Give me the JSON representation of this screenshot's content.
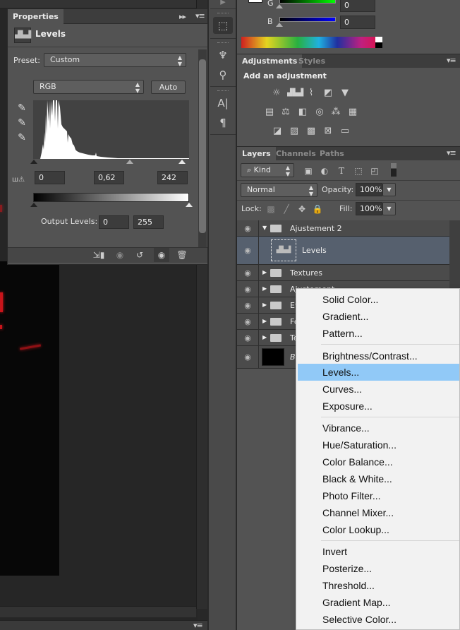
{
  "properties_panel": {
    "tab_label": "Properties",
    "collapse_icon": "double-chevron-right-icon",
    "menu_icon": "panel-menu-icon",
    "title": "Levels",
    "title_icon": "levels-histogram-icon",
    "preset_label": "Preset:",
    "preset_value": "Custom",
    "channel_value": "RGB",
    "auto_button": "Auto",
    "eyedroppers": [
      "black-point-eyedropper-icon",
      "gray-point-eyedropper-icon",
      "white-point-eyedropper-icon"
    ],
    "input_black": "0",
    "input_gamma": "0,62",
    "input_white": "242",
    "output_label": "Output Levels:",
    "output_black": "0",
    "output_white": "255",
    "footer_icons": [
      "clip-to-layer-icon",
      "view-previous-state-icon",
      "reset-icon",
      "visibility-eye-icon",
      "delete-icon"
    ]
  },
  "histogram": {
    "input_black_level": 0,
    "input_gamma": 0.62,
    "input_white_level": 242,
    "range": [
      0,
      255
    ]
  },
  "dock": {
    "icons": [
      "3d-icon",
      "brush-presets-icon",
      "brushes-icon",
      "character-icon",
      "paragraph-icon"
    ]
  },
  "color_panel": {
    "channels": [
      {
        "label": "G",
        "value": "0"
      },
      {
        "label": "B",
        "value": "0"
      }
    ]
  },
  "adjustments_panel": {
    "tabs": [
      "Adjustments",
      "Styles"
    ],
    "subtitle": "Add an adjustment",
    "icons_row1": [
      "brightness-contrast-icon",
      "levels-icon",
      "curves-icon",
      "exposure-icon",
      "gradient-triangle-icon"
    ],
    "icons_row2": [
      "vibrance-icon",
      "color-balance-icon",
      "black-white-icon",
      "photo-filter-icon",
      "channel-mixer-icon",
      "color-lookup-icon"
    ],
    "icons_row3": [
      "invert-icon",
      "posterize-icon",
      "threshold-icon",
      "selective-color-icon",
      "gradient-map-icon"
    ]
  },
  "layers_panel": {
    "tabs": [
      "Layers",
      "Channels",
      "Paths"
    ],
    "filter_value": "Kind",
    "blend_mode": "Normal",
    "opacity_label": "Opacity:",
    "opacity_value": "100%",
    "lock_label": "Lock:",
    "fill_label": "Fill:",
    "fill_value": "100%",
    "layers": [
      {
        "name": "Ajustement 2",
        "type": "group",
        "expanded": true
      },
      {
        "name": "Levels",
        "type": "adjustment",
        "selected": true
      },
      {
        "name": "Textures",
        "type": "group"
      },
      {
        "name": "Ajustement",
        "type": "group"
      },
      {
        "name": "Ef",
        "type": "group"
      },
      {
        "name": "Fo",
        "type": "group"
      },
      {
        "name": "Te",
        "type": "group"
      },
      {
        "name": "B",
        "type": "background"
      }
    ]
  },
  "context_menu": {
    "items": [
      {
        "label": "Solid Color..."
      },
      {
        "label": "Gradient..."
      },
      {
        "label": "Pattern..."
      },
      {
        "label": "Brightness/Contrast..."
      },
      {
        "label": "Levels...",
        "highlighted": true
      },
      {
        "label": "Curves..."
      },
      {
        "label": "Exposure..."
      },
      {
        "label": "Vibrance..."
      },
      {
        "label": "Hue/Saturation..."
      },
      {
        "label": "Color Balance..."
      },
      {
        "label": "Black & White..."
      },
      {
        "label": "Photo Filter..."
      },
      {
        "label": "Channel Mixer..."
      },
      {
        "label": "Color Lookup..."
      },
      {
        "label": "Invert"
      },
      {
        "label": "Posterize..."
      },
      {
        "label": "Threshold..."
      },
      {
        "label": "Gradient Map..."
      },
      {
        "label": "Selective Color..."
      }
    ]
  },
  "colors": {
    "panel_bg": "#535353",
    "selected_layer": "#56606e",
    "menu_highlight": "#91c9f7"
  }
}
